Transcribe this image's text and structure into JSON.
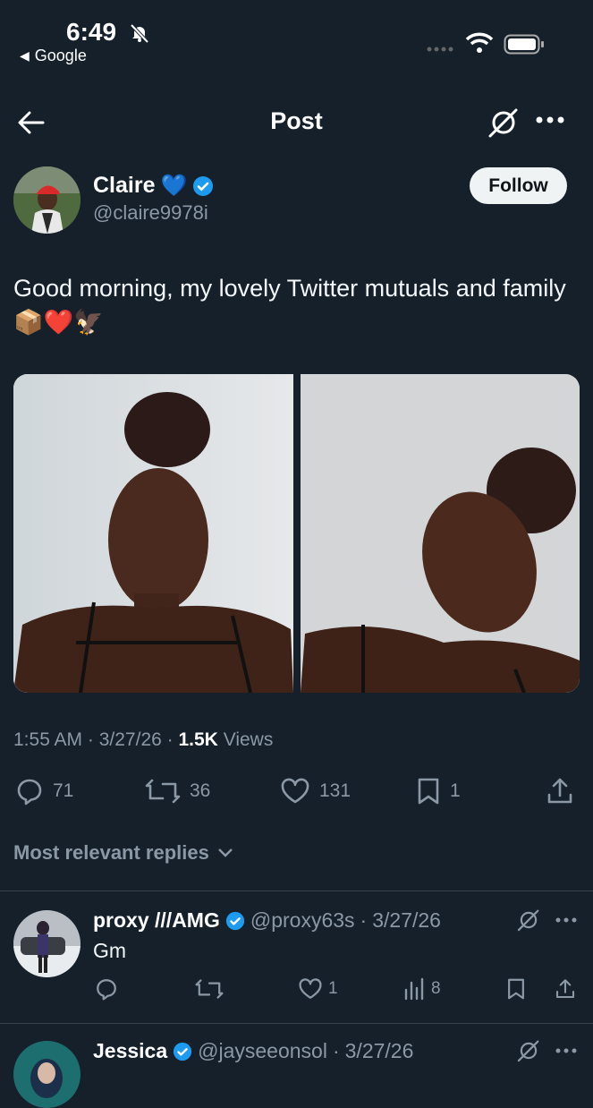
{
  "status_bar": {
    "time": "6:49",
    "back_app": "Google"
  },
  "header": {
    "title": "Post"
  },
  "author": {
    "name": "Claire",
    "emoji": "💙",
    "handle": "@claire9978i",
    "follow_label": "Follow"
  },
  "post": {
    "text": "Good morning, my lovely Twitter mutuals and family 📦❤️🦅",
    "time": "1:55 AM",
    "date": "3/27/26",
    "views_count": "1.5K",
    "views_label": "Views"
  },
  "actions": {
    "replies": "71",
    "reposts": "36",
    "likes": "131",
    "bookmarks": "1"
  },
  "replies_section": {
    "label": "Most relevant replies"
  },
  "replies": [
    {
      "name": "proxy ///AMG",
      "handle": "@proxy63s",
      "date": "3/27/26",
      "text": "Gm",
      "likes": "1",
      "views": "8"
    },
    {
      "name": "Jessica",
      "handle": "@jayseeonsol",
      "date": "3/27/26"
    }
  ],
  "colors": {
    "background": "#15202b",
    "verified": "#1d9bf0",
    "muted": "#8b98a5"
  }
}
